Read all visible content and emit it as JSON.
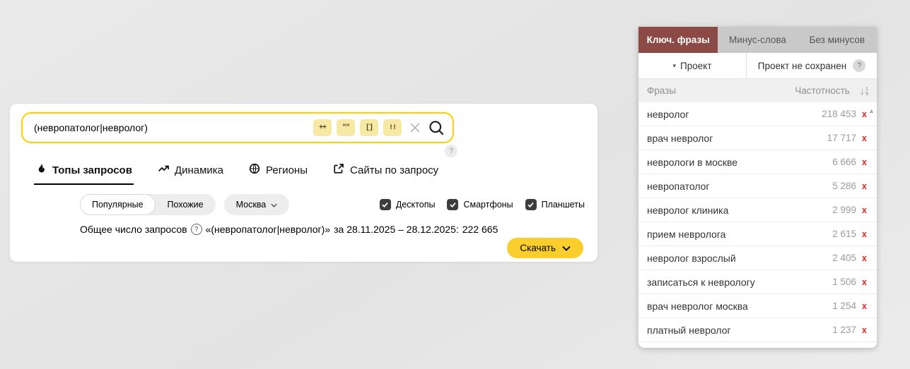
{
  "colors": {
    "accent_yellow": "#ffcc00",
    "button_yellow": "#fbce2d",
    "operator_bg": "#f7e9a3",
    "panel_active_tab": "#8b4a45",
    "remove_red": "#e8231d"
  },
  "search": {
    "query": "(невропатолог|невролог)",
    "operators": [
      "++",
      "\"\"",
      "[]",
      "!!"
    ],
    "help_glyph": "?"
  },
  "nav_tabs": [
    {
      "label": "Топы запросов",
      "icon": "flame-icon",
      "active": true
    },
    {
      "label": "Динамика",
      "icon": "trend-icon",
      "active": false
    },
    {
      "label": "Регионы",
      "icon": "globe-icon",
      "active": false
    },
    {
      "label": "Сайты по запросу",
      "icon": "external-link-icon",
      "active": false
    }
  ],
  "filters": {
    "view_options": [
      "Популярные",
      "Похожие"
    ],
    "active_view": "Популярные",
    "region": "Москва",
    "devices": [
      {
        "label": "Десктопы",
        "checked": true
      },
      {
        "label": "Смартфоны",
        "checked": true
      },
      {
        "label": "Планшеты",
        "checked": true
      }
    ]
  },
  "summary": {
    "prefix": "Общее число запросов",
    "help_glyph": "?",
    "query_quoted": "«(невропатолог|невролог)»",
    "period": "за 28.11.2025 – 28.12.2025:",
    "total": "222 665"
  },
  "download": {
    "label": "Скачать"
  },
  "panel": {
    "tabs": [
      {
        "label": "Ключ. фразы",
        "active": true
      },
      {
        "label": "Минус-слова",
        "active": false
      },
      {
        "label": "Без минусов",
        "active": false
      }
    ],
    "project": {
      "caret_glyph": "▾",
      "selector": "Проект",
      "status": "Проект не сохранен",
      "help_glyph": "?"
    },
    "columns": {
      "phrases": "Фразы",
      "frequency": "Частотность"
    },
    "sort_icon": {
      "arrow": "↓",
      "top": "1",
      "bottom": "9"
    },
    "remove_glyph": "x",
    "scroll_up_glyph": "▲",
    "rows": [
      {
        "phrase": "невролог",
        "frequency": "218 453"
      },
      {
        "phrase": "врач невролог",
        "frequency": "17 717"
      },
      {
        "phrase": "неврологи в москве",
        "frequency": "6 666"
      },
      {
        "phrase": "невропатолог",
        "frequency": "5 286"
      },
      {
        "phrase": "невролог клиника",
        "frequency": "2 999"
      },
      {
        "phrase": "прием невролога",
        "frequency": "2 615"
      },
      {
        "phrase": "невролог взрослый",
        "frequency": "2 405"
      },
      {
        "phrase": "записаться к неврологу",
        "frequency": "1 506"
      },
      {
        "phrase": "врач невролог москва",
        "frequency": "1 254"
      },
      {
        "phrase": "платный невролог",
        "frequency": "1 237"
      }
    ]
  }
}
